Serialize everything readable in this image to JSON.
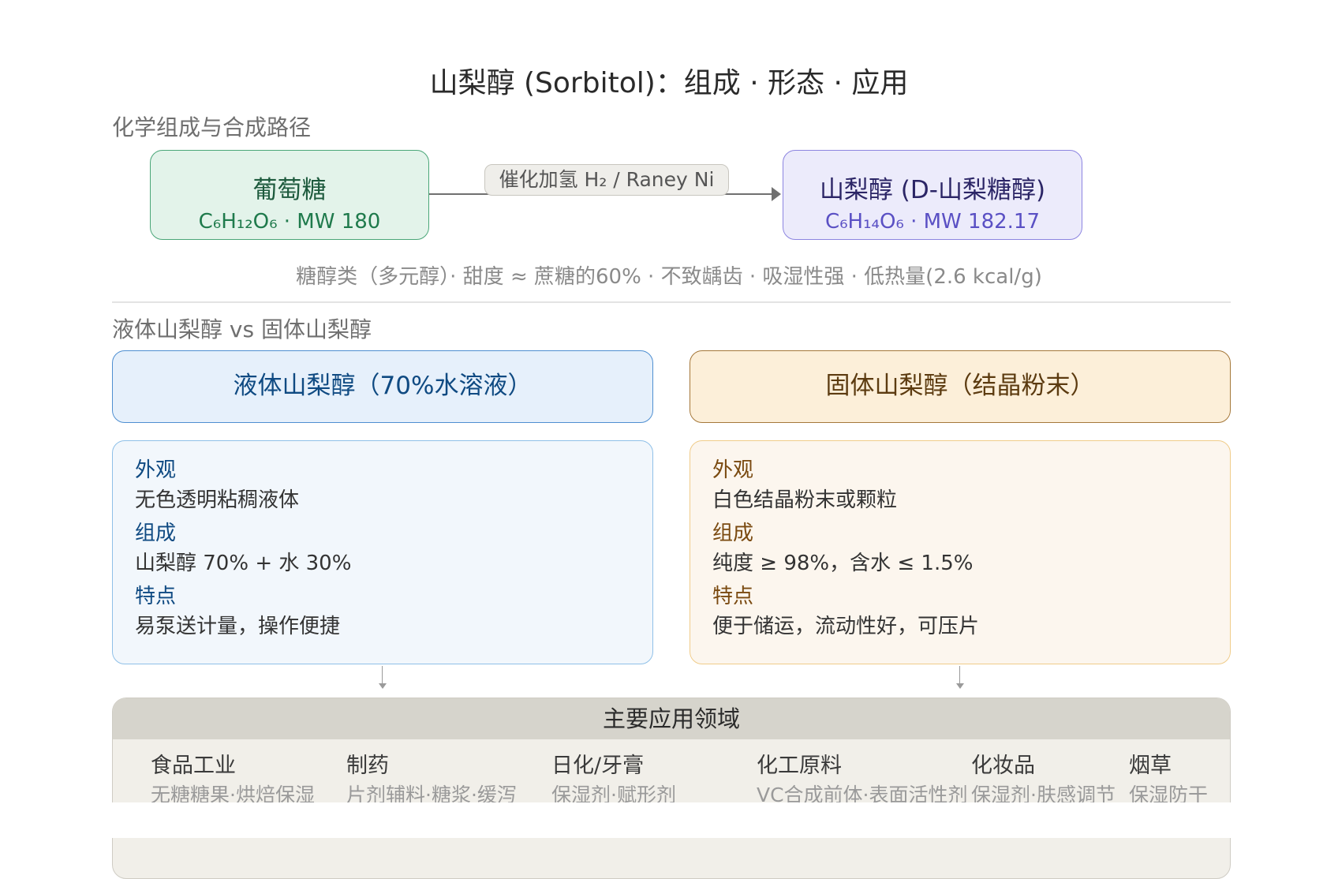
{
  "title": "山梨醇 (Sorbitol)：组成 · 形态 · 应用",
  "section1_label": "化学组成与合成路径",
  "glucose": {
    "name": "葡萄糖",
    "formula": "C₆H₁₂O₆ · MW 180"
  },
  "reaction": {
    "catalyst": "催化加氢 H₂ / Raney Ni"
  },
  "sorbitol": {
    "name": "山梨醇 (D-山梨糖醇)",
    "formula": "C₆H₁₄O₆ · MW 182.17"
  },
  "properties": "糖醇类（多元醇）· 甜度 ≈ 蔗糖的60% · 不致龋齿 · 吸湿性强 · 低热量(2.6 kcal/g)",
  "section2_label": "液体山梨醇 vs 固体山梨醇",
  "liquid": {
    "header": "液体山梨醇（70%水溶液）",
    "items": [
      {
        "key": "外观",
        "value": "无色透明粘稠液体"
      },
      {
        "key": "组成",
        "value": "山梨醇 70% + 水 30%"
      },
      {
        "key": "特点",
        "value": "易泵送计量，操作便捷"
      }
    ]
  },
  "solid": {
    "header": "固体山梨醇（结晶粉末）",
    "items": [
      {
        "key": "外观",
        "value": "白色结晶粉末或颗粒"
      },
      {
        "key": "组成",
        "value": "纯度 ≥ 98%，含水 ≤ 1.5%"
      },
      {
        "key": "特点",
        "value": "便于储运，流动性好，可压片"
      }
    ]
  },
  "applications": {
    "header": "主要应用领域",
    "items": [
      {
        "name": "食品工业",
        "desc": "无糖糖果·烘焙保湿"
      },
      {
        "name": "制药",
        "desc": "片剂辅料·糖浆·缓泻"
      },
      {
        "name": "日化/牙膏",
        "desc": "保湿剂·赋形剂"
      },
      {
        "name": "化工原料",
        "desc": "VC合成前体·表面活性剂"
      },
      {
        "name": "化妆品",
        "desc": "保湿剂·肤感调节"
      },
      {
        "name": "烟草",
        "desc": "保湿防干"
      }
    ]
  },
  "colors": {
    "glucose_accent": "#4aa678",
    "sorbitol_accent": "#8c84e0",
    "liquid_accent": "#4f8fd1",
    "solid_accent": "#a5783a"
  }
}
